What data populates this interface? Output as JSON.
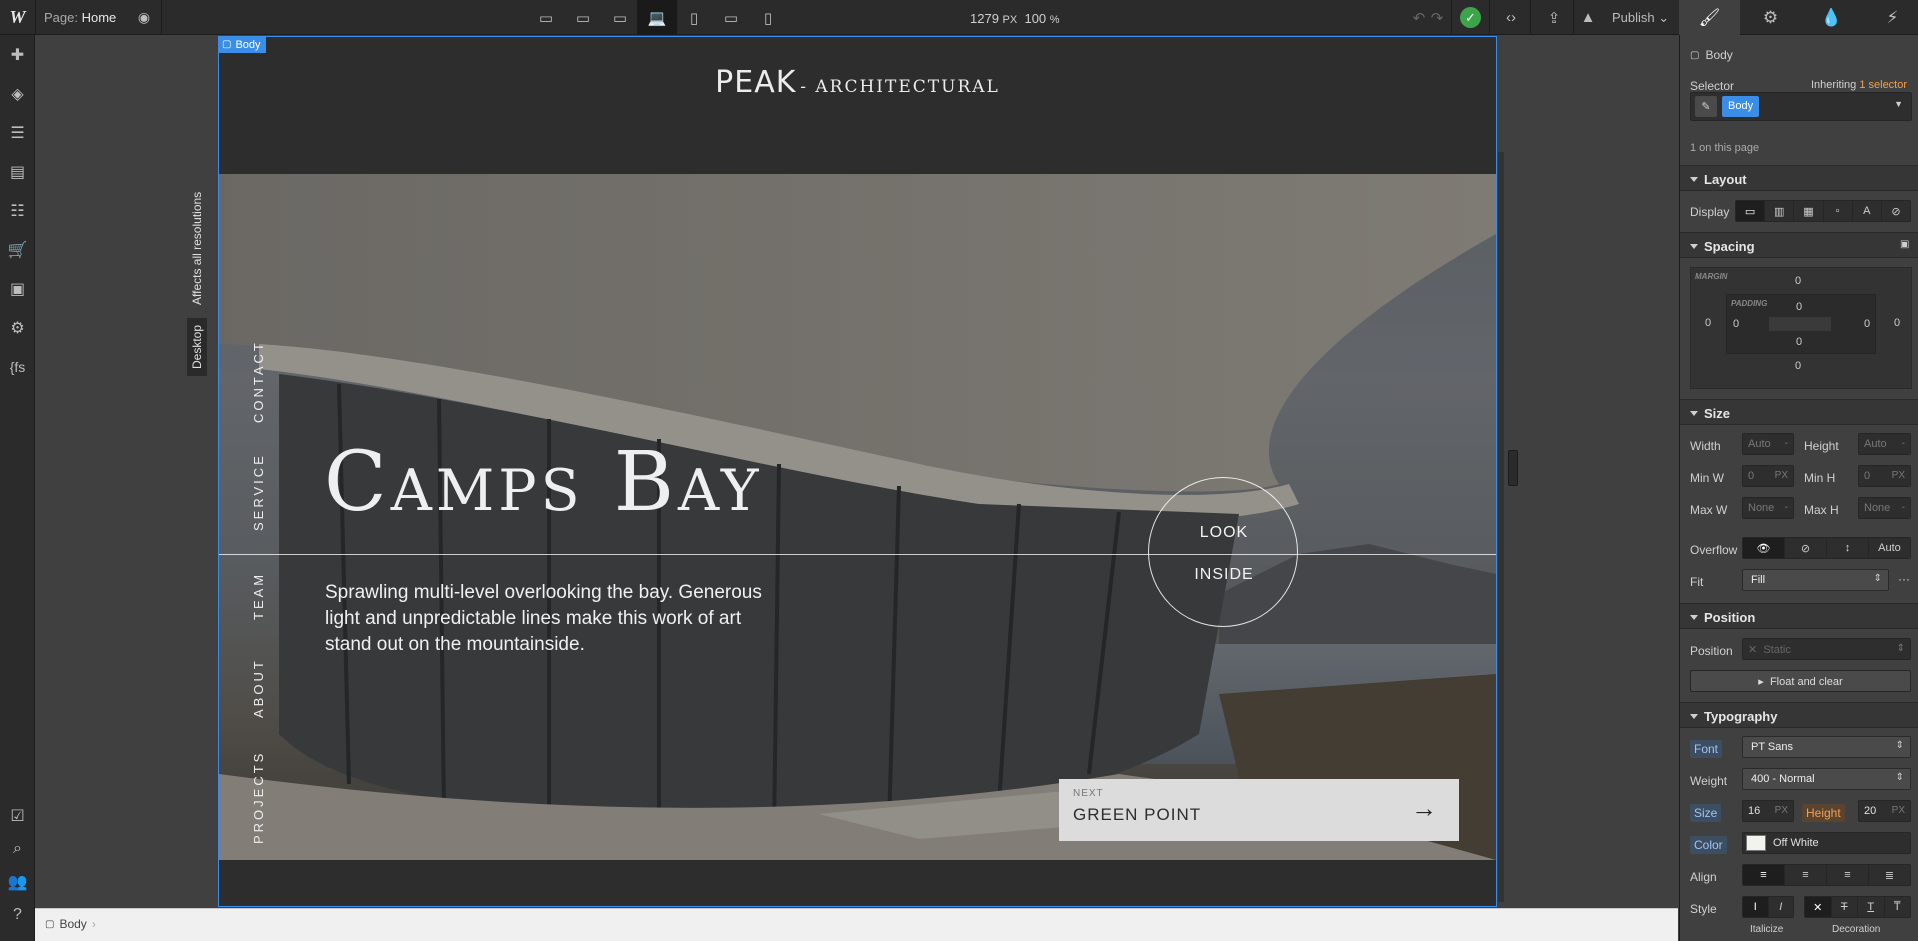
{
  "topbar": {
    "page_label": "Page:",
    "page_name": "Home",
    "width_value": "1279",
    "width_unit": "PX",
    "zoom": "100",
    "zoom_unit": "%",
    "publish_label": "Publish",
    "devices": [
      "desktop-xl",
      "desktop-l",
      "desktop-m",
      "desktop",
      "tablet",
      "tablet-landscape",
      "mobile"
    ]
  },
  "canvas": {
    "body_tag": "Body",
    "vertical_tab_desktop": "Desktop",
    "vertical_tab_affects": "Affects all resolutions",
    "brand_main": "PEAK",
    "brand_sub": "- ARCHITECTURAL",
    "nav": [
      "PROJECTS",
      "ABOUT",
      "TEAM",
      "SERVICE",
      "CONTACT"
    ],
    "title": "Camps Bay",
    "description": "Sprawling multi-level overlooking the bay. Generous light and unpredictable lines make this work of art stand out on the mountainside.",
    "circle_line1": "LOOK",
    "circle_line2": "INSIDE",
    "next_label": "NEXT",
    "next_title": "GREEN POINT"
  },
  "breadcrumb": {
    "item": "Body"
  },
  "right_panel": {
    "element_name": "Body",
    "selector_label": "Selector",
    "inheriting_label": "Inheriting",
    "inheriting_count": "1 selector",
    "selector_chip": "Body",
    "on_page": "1 on this page",
    "layout": {
      "title": "Layout",
      "display_label": "Display"
    },
    "spacing": {
      "title": "Spacing",
      "margin_label": "MARGIN",
      "padding_label": "PADDING",
      "margin_top": "0",
      "margin_left": "0",
      "margin_right": "0",
      "margin_bottom": "0",
      "padding_top": "0",
      "padding_left": "0",
      "padding_right": "0",
      "padding_bottom": "0"
    },
    "size": {
      "title": "Size",
      "width_label": "Width",
      "width_val": "Auto",
      "width_unit": "-",
      "height_label": "Height",
      "height_val": "Auto",
      "height_unit": "-",
      "minw_label": "Min W",
      "minw_val": "0",
      "minw_unit": "PX",
      "minh_label": "Min H",
      "minh_val": "0",
      "minh_unit": "PX",
      "maxw_label": "Max W",
      "maxw_val": "None",
      "maxw_unit": "-",
      "maxh_label": "Max H",
      "maxh_val": "None",
      "maxh_unit": "-",
      "overflow_label": "Overflow",
      "overflow_auto": "Auto",
      "fit_label": "Fit",
      "fit_val": "Fill"
    },
    "position": {
      "title": "Position",
      "position_label": "Position",
      "position_val": "Static",
      "float_label": "Float and clear"
    },
    "typography": {
      "title": "Typography",
      "font_label": "Font",
      "font_val": "PT Sans",
      "weight_label": "Weight",
      "weight_val": "400 - Normal",
      "size_label": "Size",
      "size_val": "16",
      "size_unit": "PX",
      "height_label": "Height",
      "height_val": "20",
      "height_unit": "PX",
      "color_label": "Color",
      "color_val": "Off White",
      "align_label": "Align",
      "style_label": "Style",
      "italicize_label": "Italicize",
      "decoration_label": "Decoration"
    }
  },
  "colors": {
    "accent": "#3b8ee8",
    "success": "#3ca54a",
    "inherit_orange": "#f0a050"
  }
}
